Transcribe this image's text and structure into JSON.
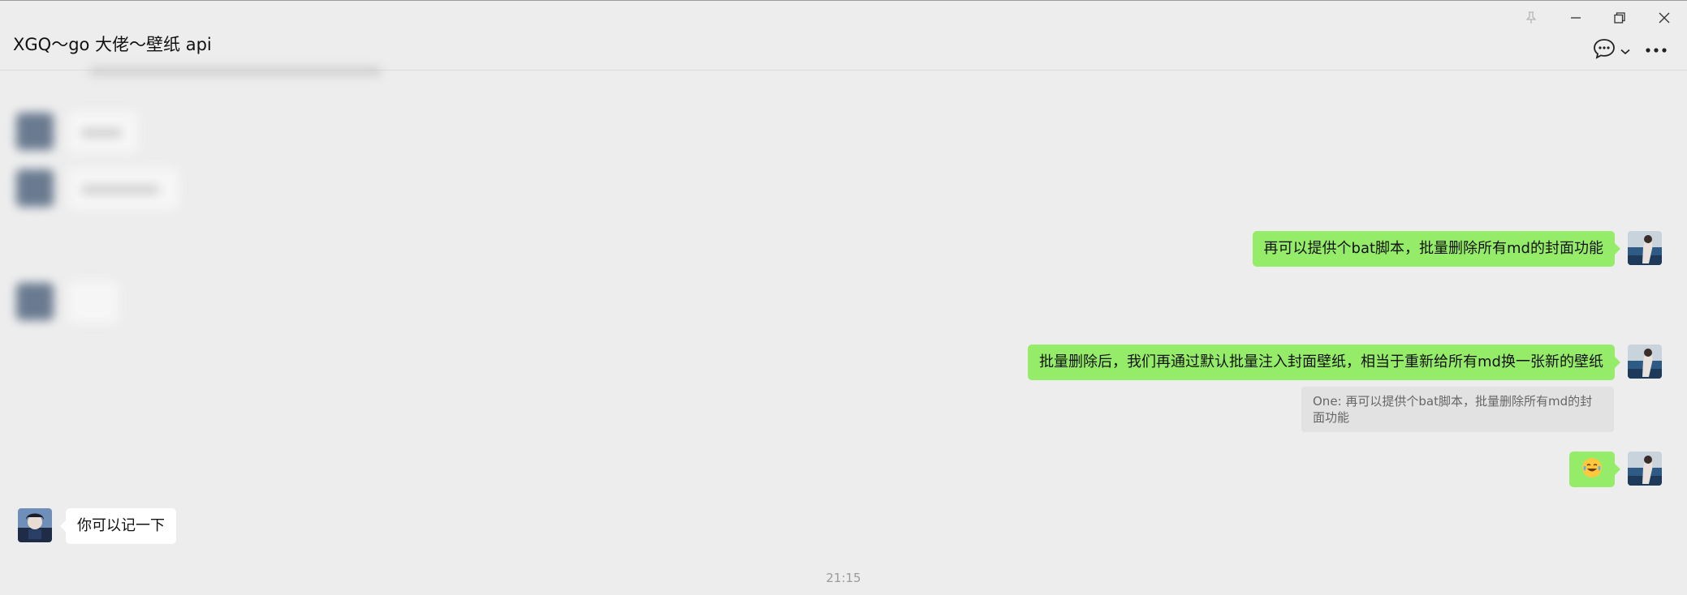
{
  "header": {
    "title": "XGQ～go 大佬～壁纸 api"
  },
  "messages": {
    "m1": "再可以提供个bat脚本，批量删除所有md的封面功能",
    "m2": "批量删除后，我们再通过默认批量注入封面壁纸，相当于重新给所有md换一张新的壁纸",
    "quote": "One: 再可以提供个bat脚本，批量删除所有md的封面功能",
    "m3_emoji": "face-with-tears-of-joy",
    "m4": "你可以记一下"
  },
  "timestamp": "21:15",
  "icons": {
    "pin": "pin-icon",
    "minimize": "minimize-icon",
    "restore": "restore-icon",
    "close": "close-icon",
    "chat": "chat-bubble-icon",
    "dropdown": "chevron-down-icon",
    "more": "more-icon"
  },
  "colors": {
    "background": "#ededed",
    "own_bubble": "#95ec69",
    "other_bubble": "#ffffff",
    "quote_bg": "#e2e2e2"
  }
}
